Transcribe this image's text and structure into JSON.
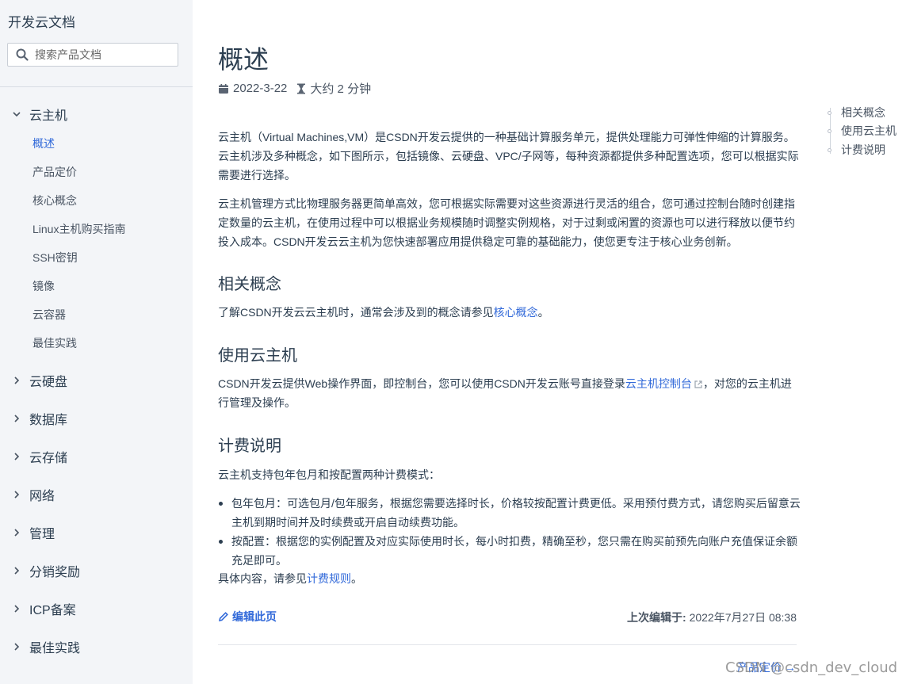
{
  "sidebar": {
    "brand": "开发云文档",
    "search_placeholder": "搜索产品文档",
    "groups": [
      {
        "label": "云主机",
        "expanded": true,
        "items": [
          "概述",
          "产品定价",
          "核心概念",
          "Linux主机购买指南",
          "SSH密钥",
          "镜像",
          "云容器",
          "最佳实践"
        ],
        "active_item": "概述"
      },
      {
        "label": "云硬盘",
        "expanded": false
      },
      {
        "label": "数据库",
        "expanded": false
      },
      {
        "label": "云存储",
        "expanded": false
      },
      {
        "label": "网络",
        "expanded": false
      },
      {
        "label": "管理",
        "expanded": false
      },
      {
        "label": "分销奖励",
        "expanded": false
      },
      {
        "label": "ICP备案",
        "expanded": false
      },
      {
        "label": "最佳实践",
        "expanded": false
      }
    ]
  },
  "main": {
    "title": "概述",
    "date": "2022-3-22",
    "read_time": "大约 2 分钟",
    "intro_1": "云主机（Virtual Machines,VM）是CSDN开发云提供的一种基础计算服务单元，提供处理能力可弹性伸缩的计算服务。云主机涉及多种概念，如下图所示，包括镜像、云硬盘、VPC/子网等，每种资源都提供多种配置选项，您可以根据实际需要进行选择。",
    "intro_2": "云主机管理方式比物理服务器更简单高效，您可根据实际需要对这些资源进行灵活的组合，您可通过控制台随时创建指定数量的云主机，在使用过程中可以根据业务规模随时调整实例规格，对于过剩或闲置的资源也可以进行释放以便节约投入成本。CSDN开发云云主机为您快速部署应用提供稳定可靠的基础能力，使您更专注于核心业务创新。",
    "section_related": {
      "heading": "相关概念",
      "text_before": "了解CSDN开发云云主机时，通常会涉及到的概念请参见",
      "link": "核心概念",
      "text_after": "。"
    },
    "section_use": {
      "heading": "使用云主机",
      "text_before": "CSDN开发云提供Web操作界面，即控制台，您可以使用CSDN开发云账号直接登录",
      "link": "云主机控制台",
      "text_after": "，对您的云主机进行管理及操作。"
    },
    "section_billing": {
      "heading": "计费说明",
      "intro": "云主机支持包年包月和按配置两种计费模式：",
      "bullets": [
        "包年包月：可选包月/包年服务，根据您需要选择时长，价格较按配置计费更低。采用预付费方式，请您购买后留意云主机到期时间并及时续费或开启自动续费功能。",
        "按配置：根据您的实例配置及对应实际使用时长，每小时扣费，精确至秒，您只需在购买前预先向账户充值保证余额充足即可。"
      ],
      "more_before": "具体内容，请参见",
      "more_link": "计费规则",
      "more_after": "。"
    },
    "edit_label": "编辑此页",
    "last_edited_label": "上次编辑于:",
    "last_edited_value": "2022年7月27日 08:38",
    "next_label": "产品定价 →"
  },
  "toc": [
    "相关概念",
    "使用云主机",
    "计费说明"
  ],
  "watermark": "CSDN @csdn_dev_cloud",
  "colors": {
    "accent": "#3169d9",
    "sidebar_bg": "#f3f5f8",
    "text": "#2c3e50"
  }
}
